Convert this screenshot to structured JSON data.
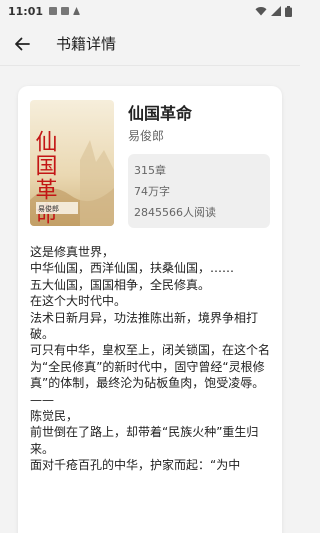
{
  "status_bar": {
    "time": "11:01",
    "icons": [
      "sim-icon",
      "download-icon",
      "a-icon",
      "wifi-icon",
      "signal-icon",
      "battery-icon"
    ]
  },
  "app_bar": {
    "back_icon": "arrow-left-icon",
    "title": "书籍详情"
  },
  "book": {
    "cover": {
      "title_text": "仙国革命",
      "author_text": "易俊郎"
    },
    "title": "仙国革命",
    "author": "易俊郎",
    "stats": {
      "chapters": "315章",
      "words": "74万字",
      "readers": "2845566人阅读"
    },
    "description": "这是修真世界，\n中华仙国，西洋仙国，扶桑仙国，……\n五大仙国，国国相争，全民修真。\n在这个大时代中。\n法术日新月异，功法推陈出新，境界争相打破。\n可只有中华，皇权至上，闭关锁国，在这个名为“全民修真”的新时代中，固守曾经“灵根修真”的体制，最终沦为砧板鱼肉，饱受凌辱。\n——\n陈觉民，\n前世倒在了路上，却带着“民族火种”重生归来。\n面对千疮百孔的中华，护家而起：“为中"
  },
  "colors": {
    "background": "#f3f3f3",
    "card": "#ffffff",
    "stats_bg": "#efefef",
    "cover_bg": "#efe6cf",
    "cover_title": "#c31515"
  }
}
